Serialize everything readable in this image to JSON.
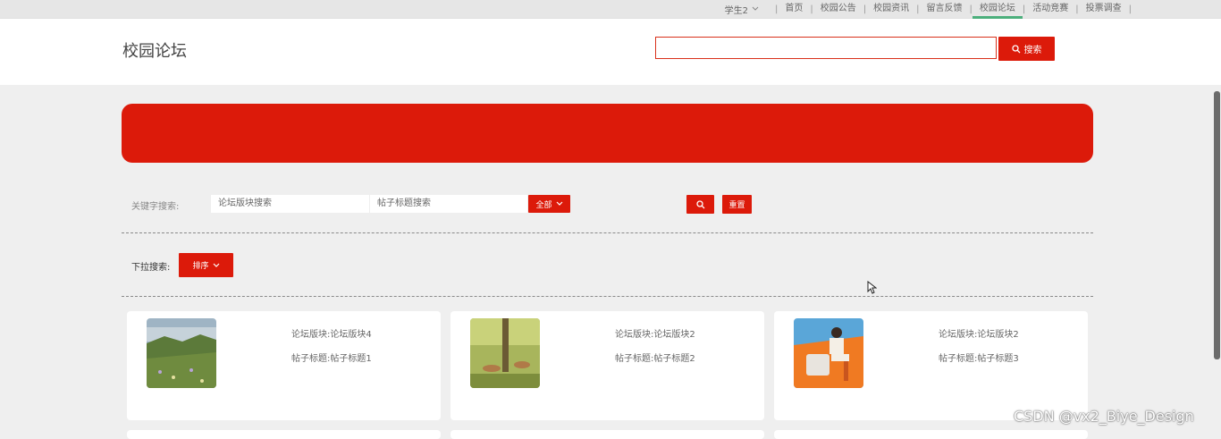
{
  "topnav": {
    "user_label": "学生2",
    "items": [
      "首页",
      "校园公告",
      "校园资讯",
      "留言反馈",
      "校园论坛",
      "活动竞赛",
      "投票调查"
    ],
    "active_index": 4
  },
  "header": {
    "title": "校园论坛",
    "search_value": "",
    "search_button_label": "搜索"
  },
  "filters": {
    "keyword_label": "关键字搜索:",
    "section_placeholder": "论坛版块搜索",
    "title_placeholder": "帖子标题搜索",
    "all_button_label": "全部",
    "reset_button_label": "重置"
  },
  "dropdown": {
    "label": "下拉搜索:",
    "sort_button_label": "排序"
  },
  "cards": [
    {
      "section": "论坛版块:论坛版块4",
      "title": "帖子标题:帖子标题1",
      "image": "mountain-meadow-photo"
    },
    {
      "section": "论坛版块:论坛版块2",
      "title": "帖子标题:帖子标题2",
      "image": "deer-in-forest-photo"
    },
    {
      "section": "论坛版块:论坛版块2",
      "title": "帖子标题:帖子标题3",
      "image": "man-sitting-orange-backdrop-photo"
    }
  ],
  "watermark": "CSDN @vx2_Biye_Design",
  "colors": {
    "accent": "#dc1a0a",
    "active_tab_underline": "#4caf7c",
    "page_bg": "#efefef"
  }
}
